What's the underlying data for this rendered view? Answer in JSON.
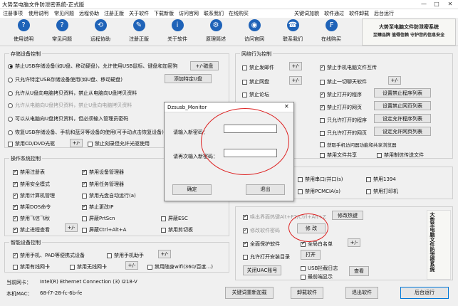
{
  "window": {
    "title": "大势至电脑文件防泄密系统-正式版",
    "min": "—",
    "max": "□",
    "close": "✕"
  },
  "menu": [
    "注册事项",
    "使用说明",
    "常见问题",
    "远程协助",
    "注册正版",
    "关于软件",
    "下载新版",
    "访问官网",
    "联系我们",
    "在线购买",
    "关键词加貌",
    "软件通过",
    "软件卸载",
    "后台运行"
  ],
  "toolbar": [
    {
      "label": "使用说明",
      "icon": "help-icon",
      "glyph": "?"
    },
    {
      "label": "常见问题",
      "icon": "question-icon",
      "glyph": "?"
    },
    {
      "label": "远程协助",
      "icon": "remote-icon",
      "glyph": "⟲"
    },
    {
      "label": "注册正版",
      "icon": "register-icon",
      "glyph": "✎"
    },
    {
      "label": "关于软件",
      "icon": "info-icon",
      "glyph": "i"
    },
    {
      "label": "原理简述",
      "icon": "gear-icon",
      "glyph": "⚙"
    },
    {
      "label": "访问官网",
      "icon": "globe-icon",
      "glyph": "◉"
    },
    {
      "label": "联系我们",
      "icon": "phone-icon",
      "glyph": "☎"
    },
    {
      "label": "在线购买",
      "icon": "cart-icon",
      "glyph": "₣"
    }
  ],
  "banner": {
    "line1": "大势至电脑文件防泄密系统",
    "line2": "至臻品牌 值得信赖 守护您的信息安全"
  },
  "storage": {
    "title": "存储设备控制",
    "options": [
      "禁止USB存储设备(如U盘、移动硬盘)，允许使用USB鼠标、键盘和加密狗",
      "只允许特定USB存储设备使用(如U盘、移动硬盘)",
      "允许从U盘向电脑拷贝资料，禁止从电脑向U盘拷贝资料",
      "允许从电脑向U盘拷贝资料，禁止U盘向电脑拷贝资料",
      "可以从电脑向U盘拷贝资料，但必须输入管理员密码",
      "恢复USB存储设备、手机和蓝牙等设备的使用(可手动点击恢复设备)"
    ],
    "cdrom": "禁用CD/DVD光驱",
    "burn": "禁止刻录但允许光驱使用",
    "add_mouse": "+/-磁盘",
    "add_usb": "添加特定U盘"
  },
  "os": {
    "title": "操作系统控制",
    "items": [
      "禁用注册表",
      "禁用设备管理器",
      "禁用安全模式",
      "禁用任务管理器",
      "禁用计算机管理",
      "禁用光盘自动运行(a)",
      "禁用DOS命令",
      "禁止更改IP",
      "禁用飞信飞秋",
      "屏蔽PrtScn",
      "屏蔽ESC",
      "禁止进程查看",
      "屏蔽Ctrl+Alt+A",
      "禁用剪切板"
    ],
    "plus": "+/-"
  },
  "smart": {
    "title": "智能设备控制",
    "items": [
      "禁用手机、PAD等便携式设备",
      "禁用手机助手",
      "禁用有线网卡",
      "禁用无线网卡",
      "禁用随身wifi(360/百度...)"
    ],
    "plus": "+/-"
  },
  "net": {
    "title": "网络行为控制",
    "left": [
      "禁止发邮件",
      "禁止网盘",
      "禁止论坛"
    ],
    "right": [
      "禁止手机电脑文件互传",
      "禁止一切聊天软件",
      "禁止打开的程序",
      "禁止打开的网页",
      "只允许打开的程序",
      "只允许打开的网页",
      "获取手机访问器功能和共享浏览器",
      "禁用文件共享",
      "禁用制信传送文件"
    ],
    "plus": "+/-",
    "btn1": "设置禁止程序列表",
    "btn2": "设置禁止网页列表",
    "btn3": "设定允许程序列表",
    "btn4": "设定允许网页列表"
  },
  "ports": [
    "禁用串口/并口(s)",
    "禁用1394",
    "禁用PCMCIA(s)",
    "禁用打印机"
  ],
  "hotkey": {
    "items": [
      "唤出界面热键Alt+F2/Ctrl+Alt+Z",
      "修改软件密码",
      "全面保护软件",
      "全局白名单",
      "允许打开安装目录",
      "USB拦截日志",
      "最前端显示"
    ],
    "change_hotkey": "修改热键",
    "change_pwd": "修 改",
    "open": "打开",
    "uac": "关闭UAC账号",
    "view": "查看",
    "plus": "+/-"
  },
  "status": {
    "nic_label": "当前网卡：",
    "nic": "Intel(R) Ethernet Connection (3) I218-V",
    "mac_label": "本机MAC：",
    "mac": "68-f7-28-fc-6b-fe"
  },
  "footer": [
    "关键词重新加载",
    "卸载软件",
    "退出软件",
    "后台运行"
  ],
  "dialog": {
    "title": "Dzsusb_Monitor",
    "close": "✕",
    "label1": "请输入新密码：",
    "label2": "请再次输入新密码：",
    "ok": "确定",
    "cancel": "退出"
  }
}
